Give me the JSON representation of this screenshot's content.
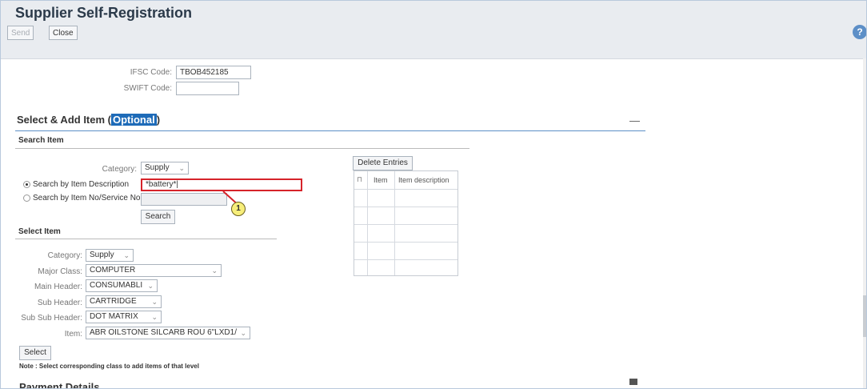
{
  "window": {
    "title": "Supplier Self-Registration"
  },
  "toolbar": {
    "send_label": "Send",
    "close_label": "Close",
    "help_glyph": "?"
  },
  "bank": {
    "ifsc_label": "IFSC Code:",
    "ifsc_value": "TBOB452185",
    "swift_label": "SWIFT Code:",
    "swift_value": ""
  },
  "section": {
    "title": "Select & Add Item (",
    "optional": "Optional",
    "close_paren": ")",
    "collapse_glyph": "—"
  },
  "search_item": {
    "title": "Search Item",
    "category_label": "Category:",
    "category_value": "Supply",
    "by_desc_label": "Search by Item Description",
    "by_desc_value": "*battery*|",
    "by_no_label": "Search by Item No/Service No",
    "by_no_value": "",
    "search_button": "Search",
    "callout": "1"
  },
  "entries": {
    "delete_button": "Delete Entries",
    "col_item": "Item",
    "col_desc": "Item description",
    "rows": 6
  },
  "select_item": {
    "title": "Select Item",
    "category_label": "Category:",
    "category_value": "Supply",
    "major_label": "Major Class:",
    "major_value": "COMPUTER",
    "main_label": "Main Header:",
    "main_value": "CONSUMABLI",
    "sub_label": "Sub Header:",
    "sub_value": "CARTRIDGE",
    "subsub_label": "Sub Sub Header:",
    "subsub_value": "DOT MATRIX",
    "item_label": "Item:",
    "item_value": "ABR OILSTONE SILCARB ROU 6\"LXD1/",
    "select_button": "Select",
    "note": "Note : Select corresponding class to add items of that level"
  },
  "payment": {
    "title": "Payment Details"
  },
  "colors": {
    "accent": "#1e6bb8",
    "highlight": "#d6232a",
    "callout_fill": "#f7ee7a"
  }
}
